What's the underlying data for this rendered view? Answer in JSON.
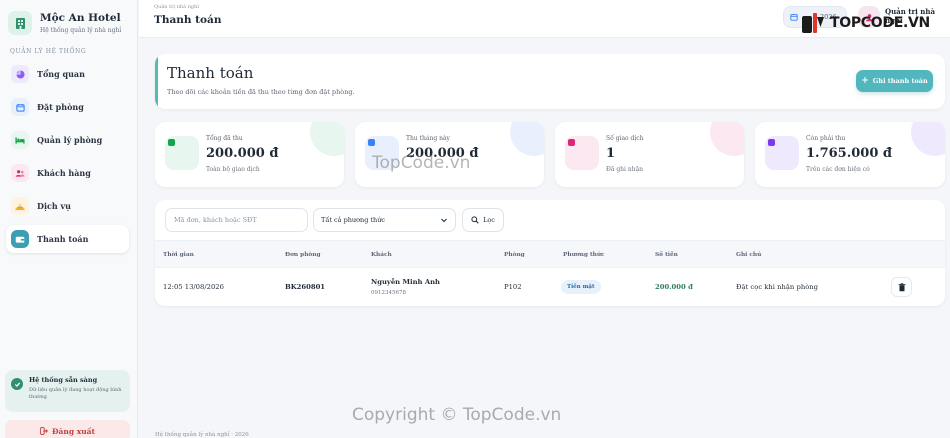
{
  "sidebar": {
    "brand_title": "Mộc An Hotel",
    "brand_sub": "Hệ thống quản lý nhà nghỉ",
    "section_label": "QUẢN LÝ HỆ THỐNG",
    "items": [
      {
        "label": "Tổng quan",
        "icon": "pie-chart-icon",
        "color": "#8b5cf6"
      },
      {
        "label": "Đặt phòng",
        "icon": "calendar-icon",
        "color": "#3b82f6"
      },
      {
        "label": "Quản lý phòng",
        "icon": "bed-icon",
        "color": "#16a34a"
      },
      {
        "label": "Khách hàng",
        "icon": "users-icon",
        "color": "#db2777"
      },
      {
        "label": "Dịch vụ",
        "icon": "service-bell-icon",
        "color": "#f59e0b"
      },
      {
        "label": "Thanh toán",
        "icon": "wallet-icon",
        "color": "#0e9aa7"
      }
    ],
    "status_title": "Hệ thống sẵn sàng",
    "status_desc": "Dữ liệu quản lý đang hoạt động bình thường",
    "logout_label": "Đăng xuất"
  },
  "header": {
    "breadcrumb": "Quản trị nhà nghỉ",
    "title": "Thanh toán",
    "date_chip": "2026",
    "user_label": "Quản trị nhà nghỉ"
  },
  "hero": {
    "title": "Thanh toán",
    "subtitle": "Theo dõi các khoản tiền đã thu theo từng đơn đặt phòng.",
    "button_label": "Ghi thanh toán"
  },
  "stats": [
    {
      "label": "Tổng đã thu",
      "value": "200.000 đ",
      "sub": "Toàn bộ giao dịch",
      "color": "#16a34a",
      "bg": "#e7f6ee"
    },
    {
      "label": "Thu tháng này",
      "value": "200.000 đ",
      "sub": "",
      "color": "#3b82f6",
      "bg": "#e9f0fd"
    },
    {
      "label": "Số giao dịch",
      "value": "1",
      "sub": "Đã ghi nhận",
      "color": "#db2777",
      "bg": "#fce8f1"
    },
    {
      "label": "Còn phải thu",
      "value": "1.765.000 đ",
      "sub": "Trên các đơn hiện có",
      "color": "#7c3aed",
      "bg": "#efe9fd"
    }
  ],
  "filters": {
    "search_placeholder": "Mã đơn, khách hoặc SĐT",
    "method_selected": "Tất cả phương thức",
    "filter_button": "Lọc"
  },
  "table": {
    "columns": [
      "Thời gian",
      "Đơn phòng",
      "Khách",
      "Phòng",
      "Phương thức",
      "Số tiền",
      "Ghi chú"
    ],
    "rows": [
      {
        "time": "12:05 13/08/2026",
        "booking": "BK260801",
        "guest_name": "Nguyễn Minh Anh",
        "guest_phone": "0912345678",
        "room": "P102",
        "method": "Tiền mặt",
        "amount": "200.000 đ",
        "note": "Đặt cọc khi nhận phòng"
      }
    ]
  },
  "footer": "Hệ thống quản lý nhà nghỉ · 2026",
  "watermark": {
    "logo_text": "TOPCODE.VN",
    "center": "TopCode.vn",
    "bottom": "Copyright © TopCode.vn"
  }
}
